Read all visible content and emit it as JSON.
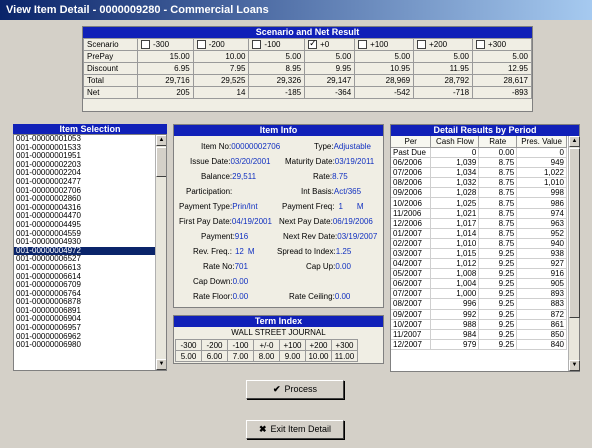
{
  "window": {
    "title": "View Item Detail - 0000009280 - Commercial Loans"
  },
  "scenario": {
    "header": "Scenario and Net Result",
    "row_labels": {
      "scenario": "Scenario",
      "prepay": "PrePay",
      "discount": "Discount",
      "total": "Total",
      "net": "Net"
    },
    "columns": [
      {
        "label": "-300",
        "checked": false,
        "prepay": "15.00",
        "discount": "6.95",
        "total": "29,716",
        "net": "205"
      },
      {
        "label": "-200",
        "checked": false,
        "prepay": "10.00",
        "discount": "7.95",
        "total": "29,525",
        "net": "14"
      },
      {
        "label": "-100",
        "checked": false,
        "prepay": "5.00",
        "discount": "8.95",
        "total": "29,326",
        "net": "-185"
      },
      {
        "label": "+0",
        "checked": true,
        "prepay": "5.00",
        "discount": "9.95",
        "total": "29,147",
        "net": "-364"
      },
      {
        "label": "+100",
        "checked": false,
        "prepay": "5.00",
        "discount": "10.95",
        "total": "28,969",
        "net": "-542"
      },
      {
        "label": "+200",
        "checked": false,
        "prepay": "5.00",
        "discount": "11.95",
        "total": "28,792",
        "net": "-718"
      },
      {
        "label": "+300",
        "checked": false,
        "prepay": "5.00",
        "discount": "12.95",
        "total": "28,617",
        "net": "-893"
      }
    ]
  },
  "item_selection": {
    "header": "Item Selection",
    "selected_index": 13,
    "items": [
      "001-00000001053",
      "001-00000001533",
      "001-00000001951",
      "001-00000002203",
      "001-00000002204",
      "001-00000002477",
      "001-00000002706",
      "001-00000002860",
      "001-00000004316",
      "001-00000004470",
      "001-00000004495",
      "001-00000004559",
      "001-00000004930",
      "001-00000004972",
      "001-00000006527",
      "001-00000006613",
      "001-00000006614",
      "001-00000006709",
      "001-00000006764",
      "001-00000006878",
      "001-00000006891",
      "001-00000006904",
      "001-00000006957",
      "001-00000006962",
      "001-00000006980"
    ]
  },
  "item_info": {
    "header": "Item Info",
    "item_no_label": "Item No:",
    "item_no": "00000002706",
    "type_label": "Type:",
    "type": "Adjustable",
    "issue_date_label": "Issue Date:",
    "issue_date": "03/20/2001",
    "maturity_label": "Maturity Date:",
    "maturity": "03/19/2011",
    "balance_label": "Balance:",
    "balance": "29,511",
    "rate_label": "Rate:",
    "rate": "8.75",
    "participation_label": "Participation:",
    "participation": "",
    "int_basis_label": "Int Basis:",
    "int_basis": "Act/365",
    "payment_type_label": "Payment Type:",
    "payment_type": "Prin/Int",
    "payment_freq_label": "Payment Freq:",
    "payment_freq_num": "1",
    "payment_freq_unit": "M",
    "first_pay_label": "First Pay Date:",
    "first_pay": "04/19/2001",
    "next_pay_label": "Next Pay Date:",
    "next_pay": "06/19/2006",
    "payment_label": "Payment:",
    "payment": "916",
    "next_rev_label": "Next Rev Date:",
    "next_rev": "03/19/2007",
    "rev_freq_label": "Rev. Freq.:",
    "rev_freq_num": "12",
    "rev_freq_unit": "M",
    "spread_label": "Spread to Index:",
    "spread": "1.25",
    "rate_no_label": "Rate No:",
    "rate_no": "701",
    "cap_up_label": "Cap Up:",
    "cap_up": "0.00",
    "cap_down_label": "Cap Down:",
    "cap_down": "0.00",
    "rate_floor_label": "Rate Floor:",
    "rate_floor": "0.00",
    "rate_ceiling_label": "Rate Ceiling:",
    "rate_ceiling": "0.00"
  },
  "term_index": {
    "header": "Term Index",
    "source": "WALL STREET JOURNAL",
    "shocks": [
      "-300",
      "-200",
      "-100",
      "+/-0",
      "+100",
      "+200",
      "+300"
    ],
    "rates": [
      "5.00",
      "6.00",
      "7.00",
      "8.00",
      "9.00",
      "10.00",
      "11.00"
    ]
  },
  "detail": {
    "header": "Detail Results by Period",
    "columns": [
      "Per",
      "Cash Flow",
      "Rate",
      "Pres. Value"
    ],
    "rows": [
      [
        "Past Due",
        "0",
        "0.00",
        "0"
      ],
      [
        "06/2006",
        "1,039",
        "8.75",
        "949"
      ],
      [
        "07/2006",
        "1,034",
        "8.75",
        "1,022"
      ],
      [
        "08/2006",
        "1,032",
        "8.75",
        "1,010"
      ],
      [
        "09/2006",
        "1,028",
        "8.75",
        "998"
      ],
      [
        "10/2006",
        "1,025",
        "8.75",
        "986"
      ],
      [
        "11/2006",
        "1,021",
        "8.75",
        "974"
      ],
      [
        "12/2006",
        "1,017",
        "8.75",
        "963"
      ],
      [
        "01/2007",
        "1,014",
        "8.75",
        "952"
      ],
      [
        "02/2007",
        "1,010",
        "8.75",
        "940"
      ],
      [
        "03/2007",
        "1,015",
        "9.25",
        "938"
      ],
      [
        "04/2007",
        "1,012",
        "9.25",
        "927"
      ],
      [
        "05/2007",
        "1,008",
        "9.25",
        "916"
      ],
      [
        "06/2007",
        "1,004",
        "9.25",
        "905"
      ],
      [
        "07/2007",
        "1,000",
        "9.25",
        "893"
      ],
      [
        "08/2007",
        "996",
        "9.25",
        "883"
      ],
      [
        "09/2007",
        "992",
        "9.25",
        "872"
      ],
      [
        "10/2007",
        "988",
        "9.25",
        "861"
      ],
      [
        "11/2007",
        "984",
        "9.25",
        "850"
      ],
      [
        "12/2007",
        "979",
        "9.25",
        "840"
      ]
    ]
  },
  "buttons": {
    "process": "Process",
    "exit": "Exit Item Detail"
  },
  "icons": {
    "process": "check-icon",
    "exit": "x-icon"
  }
}
